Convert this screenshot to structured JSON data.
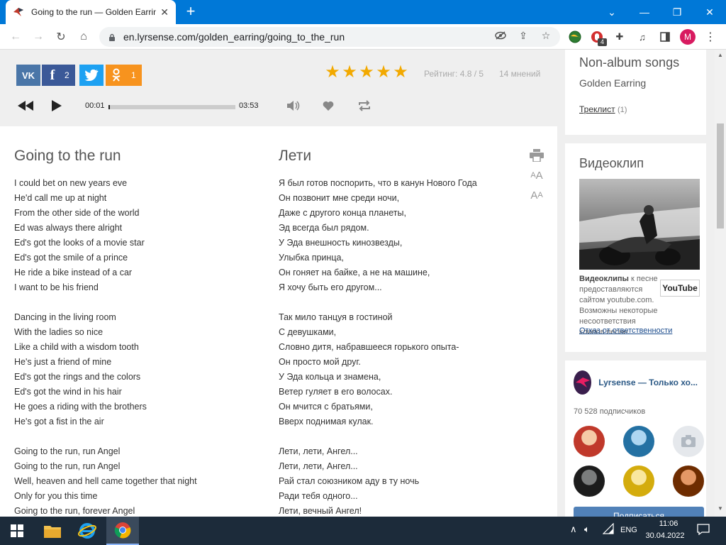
{
  "browser": {
    "tab_title": "Going to the run — Golden Earring",
    "url": "en.lyrsense.com/golden_earring/going_to_the_run",
    "extension_badge": "4",
    "profile_initial": "M"
  },
  "player": {
    "social": [
      {
        "name": "vk",
        "label": "VK",
        "count": "",
        "color": "#4a76a8"
      },
      {
        "name": "facebook",
        "label": "f",
        "count": "2",
        "color": "#3b5998"
      },
      {
        "name": "twitter",
        "label": "t",
        "count": "",
        "color": "#1da1f2"
      },
      {
        "name": "odnoklassniki",
        "label": "OK",
        "count": "1",
        "color": "#f7931e"
      }
    ],
    "stars": 5,
    "rating": "Рейтинг: 4.8 / 5",
    "opinions": "14 мнений",
    "current_time": "00:01",
    "total_time": "03:53",
    "progress": 0.01
  },
  "lyrics": {
    "original_title": "Going to the run",
    "translation_title": "Лети",
    "original": [
      "I could bet on new years eve",
      "He'd call me up at night",
      "From the other side of the world",
      "Ed was always there alright",
      "Ed's got the looks of a movie star",
      "Ed's got the smile of a prince",
      "He ride a bike instead of a car",
      "I want to be his friend",
      "",
      "Dancing in the living room",
      "With the ladies so nice",
      "Like a child with a wisdom tooth",
      "He's just a friend of mine",
      "Ed's got the rings and the colors",
      "Ed's got the wind in his hair",
      "He goes a riding with the brothers",
      "He's got a fist in the air",
      "",
      "Going to the run, run Angel",
      "Going to the run, run Angel",
      "Well, heaven and hell came together that night",
      "Only for you this time",
      "Going to the run, forever Angel"
    ],
    "translation": [
      "Я был готов поспорить, что в канун Нового Года",
      "Он позвонит мне среди ночи,",
      "Даже с другого конца планеты,",
      "Эд всегда был рядом.",
      "У Эда внешность кинозвезды,",
      "Улыбка принца,",
      "Он гоняет на байке, а не на машине,",
      "Я хочу быть его другом...",
      "",
      "Так мило танцуя в гостиной",
      "С девушками,",
      "Словно дитя, набравшееся горького опыта-",
      "Он просто мой друг.",
      "У Эда кольца и знамена,",
      "Ветер гуляет в его волосах.",
      "Он мчится с братьями,",
      "Вверх поднимая кулак.",
      "",
      "Лети, лети, Ангел...",
      "Лети, лети, Ангел...",
      "Рай стал союзником аду в ту ночь",
      "Ради тебя одного...",
      "Лети, вечный Ангел!"
    ]
  },
  "sidebar": {
    "album_title": "Non-album songs",
    "artist": "Golden Earring",
    "tracklist_label": "Треклист",
    "tracklist_count": "(1)",
    "video_title": "Видеоклип",
    "video_note_bold": "Видеоклипы",
    "video_note_text": " к песне предоставляются сайтом youtube.com. Возможны некоторые несоответствия клипов песне.",
    "youtube_logo": "YouTube",
    "disclaimer": "Отказ от ответственности",
    "vk_group_name": "Lyrsense — Только хо...",
    "vk_subscribers": "70 528 подписчиков",
    "vk_subscribe_button": "Подписаться"
  },
  "taskbar": {
    "lang": "ENG",
    "time": "11:06",
    "date": "30.04.2022"
  }
}
